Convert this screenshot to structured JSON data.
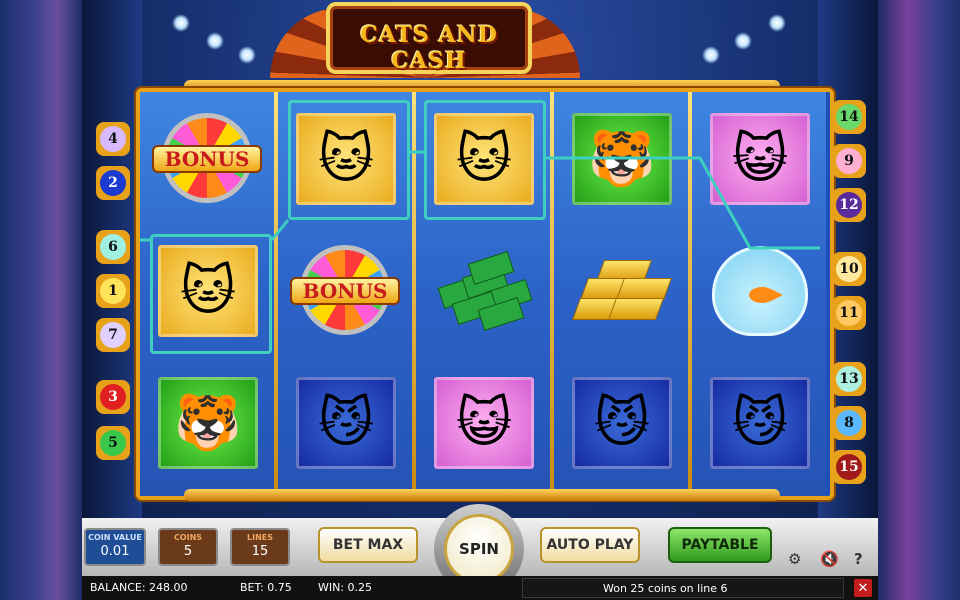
{
  "game": {
    "title": "CATS AND CASH"
  },
  "reels": [
    [
      "bonus",
      "gangster-cat",
      "tabby-cat"
    ],
    [
      "gangster-cat",
      "bonus",
      "lady-cat"
    ],
    [
      "gangster-cat",
      "cash",
      "persian-cat"
    ],
    [
      "tabby-cat",
      "gold-bars",
      "lady-cat"
    ],
    [
      "persian-cat",
      "fishbowl",
      "lady-cat"
    ]
  ],
  "symbols": {
    "bonus_label": "BONUS"
  },
  "lines_left": [
    "4",
    "2",
    "6",
    "1",
    "7",
    "3",
    "5"
  ],
  "lines_right": [
    "14",
    "9",
    "12",
    "10",
    "11",
    "13",
    "8",
    "15"
  ],
  "controls": {
    "coin_value_label": "COIN VALUE",
    "coin_value": "0.01",
    "coins_label": "COINS",
    "coins": "5",
    "lines_label": "LINES",
    "lines": "15",
    "bet_max": "BET MAX",
    "spin": "SPIN",
    "auto_play": "AUTO PLAY",
    "paytable": "PAYTABLE",
    "help": "?"
  },
  "status": {
    "balance": "BALANCE: 248.00",
    "bet": "BET: 0.75",
    "win": "WIN: 0.25",
    "message": "Won 25 coins on line 6",
    "close": "✕"
  },
  "colors": {
    "frame": "#e8a21a",
    "payline": "#3ecfc0",
    "coin_value_box": "#1f4e96",
    "coins_box": "#6a3a1a",
    "lines_box": "#6a3a1a"
  }
}
